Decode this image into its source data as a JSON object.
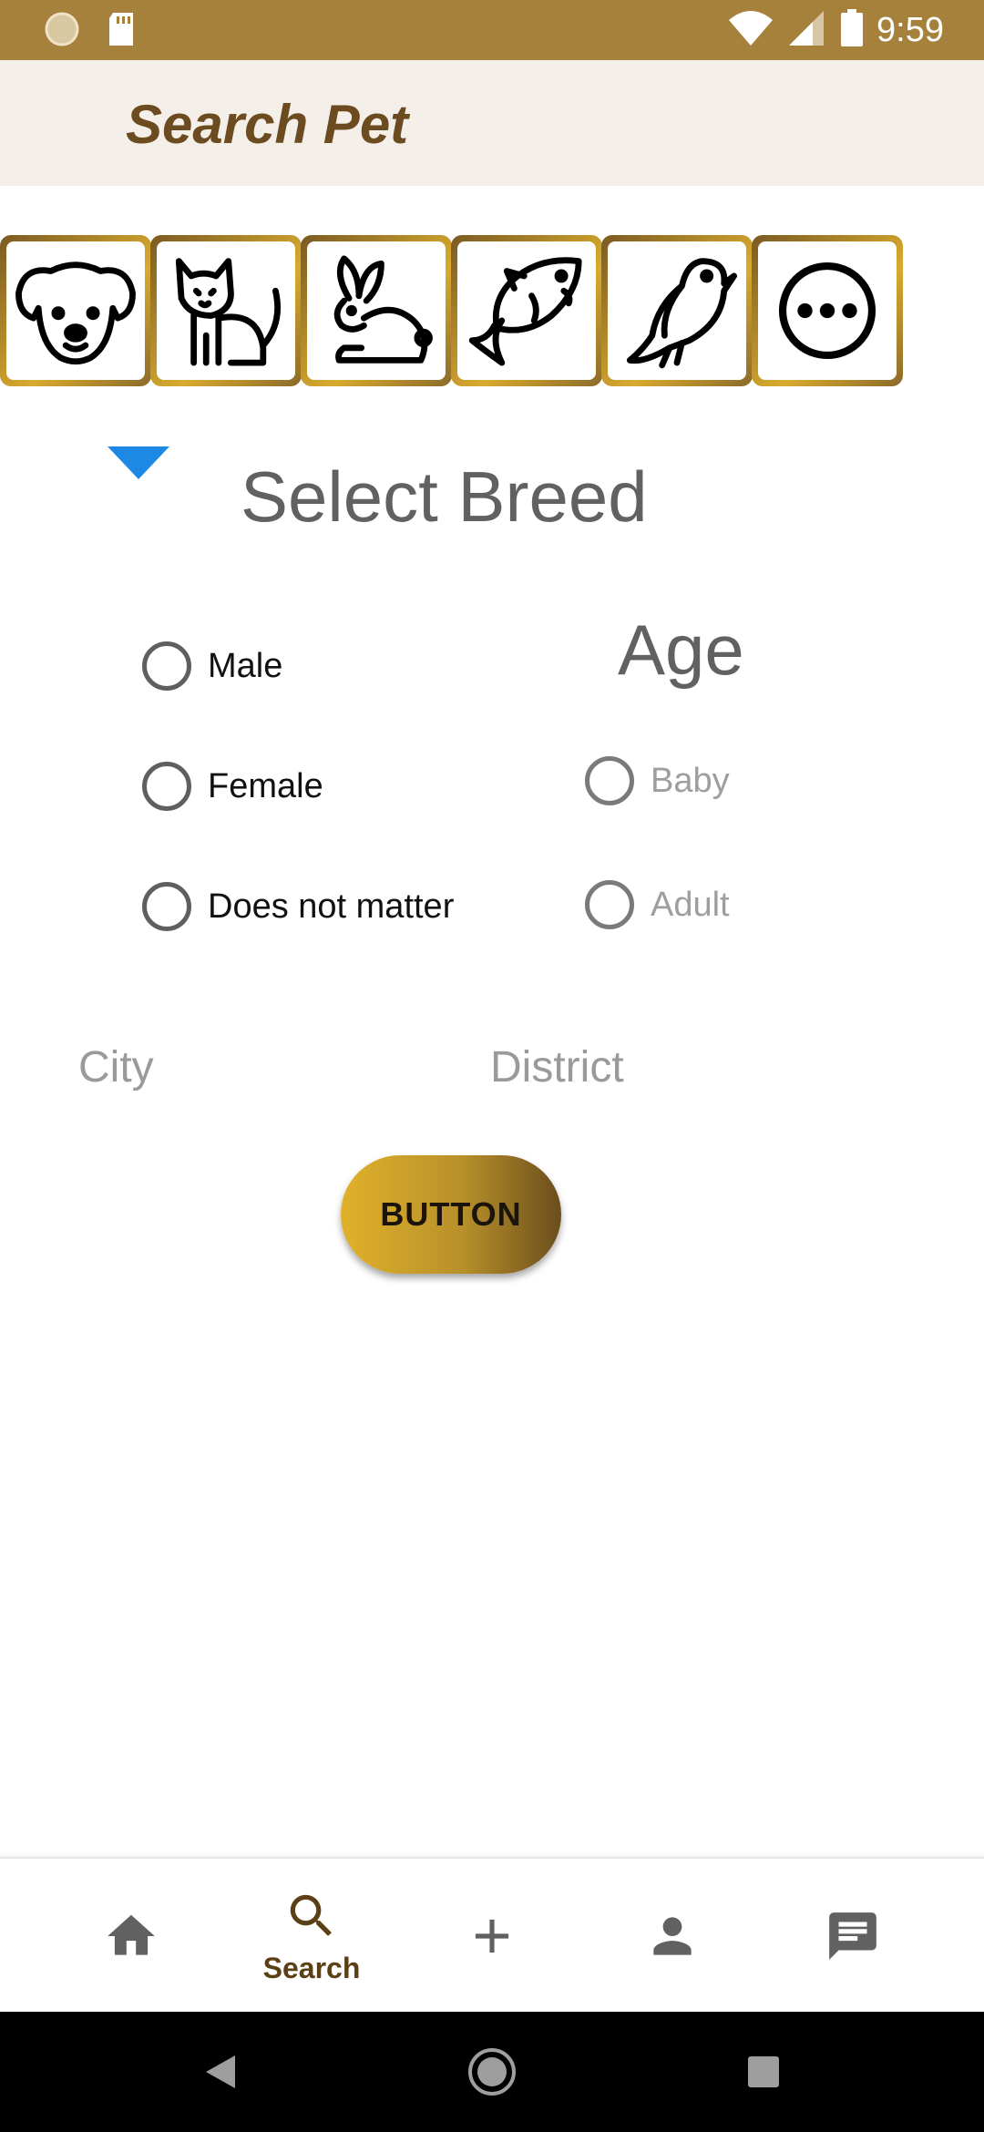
{
  "status_bar": {
    "time": "9:59",
    "left_icons": [
      "loading-icon",
      "sd-card-icon"
    ],
    "right_icons": [
      "wifi-icon",
      "signal-icon",
      "battery-icon"
    ]
  },
  "app_bar": {
    "title": "Search Pet"
  },
  "pet_types": [
    {
      "name": "dog",
      "icon": "dog-icon"
    },
    {
      "name": "cat",
      "icon": "cat-icon"
    },
    {
      "name": "rabbit",
      "icon": "rabbit-icon"
    },
    {
      "name": "fish",
      "icon": "fish-icon"
    },
    {
      "name": "bird",
      "icon": "bird-icon"
    },
    {
      "name": "more",
      "icon": "more-icon"
    }
  ],
  "breed": {
    "label": "Select Breed"
  },
  "gender": {
    "options": [
      "Male",
      "Female",
      "Does not matter"
    ]
  },
  "age": {
    "title": "Age",
    "options": [
      "Baby",
      "Adult"
    ]
  },
  "location": {
    "city_hint": "City",
    "district_hint": "District"
  },
  "button": {
    "label": "BUTTON"
  },
  "bottom_nav": {
    "active": "Search",
    "items": [
      {
        "icon": "home-icon",
        "label": ""
      },
      {
        "icon": "search-icon",
        "label": "Search"
      },
      {
        "icon": "add-icon",
        "label": ""
      },
      {
        "icon": "person-icon",
        "label": ""
      },
      {
        "icon": "chat-icon",
        "label": ""
      }
    ]
  },
  "colors": {
    "status_bar": "#a5813c",
    "app_bar": "#f4f0e9",
    "title": "#6b4b1f",
    "caret": "#1e88e5",
    "accent_gold": "#d8aa2e"
  }
}
